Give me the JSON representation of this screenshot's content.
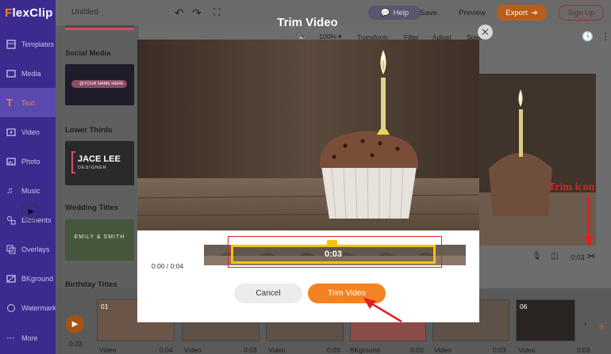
{
  "app": {
    "logo_prefix": "F",
    "logo_rest": "lexClip",
    "title": "Untitled"
  },
  "header": {
    "help": "Help",
    "save": "Save",
    "preview": "Preview",
    "export": "Export",
    "signup": "Sign Up"
  },
  "toolbar": {
    "zoom": "100%",
    "transform": "Transform",
    "filter": "Filter",
    "adjust": "Adjust",
    "speed": "Speed"
  },
  "sidebar": {
    "items": [
      {
        "label": "Templates"
      },
      {
        "label": "Media"
      },
      {
        "label": "Text"
      },
      {
        "label": "Video"
      },
      {
        "label": "Photo"
      },
      {
        "label": "Music"
      },
      {
        "label": "Elements"
      },
      {
        "label": "Overlays"
      },
      {
        "label": "BKground"
      },
      {
        "label": "Watermark"
      },
      {
        "label": "More"
      }
    ]
  },
  "panel": {
    "sections": [
      "Social Media",
      "Lower Thirds",
      "Wedding Titles",
      "Birthday Titles"
    ],
    "social_thumb_text": "@YOUR NAME HERE",
    "lower_name": "JACE LEE",
    "lower_sub": "DESIGNER",
    "wedding_text": "EMILY & SMITH"
  },
  "modal": {
    "title": "Trim Video",
    "time": "0:00 / 0:04",
    "selection_time": "0:03",
    "cancel": "Cancel",
    "trim": "Trim Video"
  },
  "preview": {
    "duration": "0:03"
  },
  "timeline": {
    "play_time": "0:23",
    "clips": [
      {
        "num": "01",
        "label": "Video",
        "dur": "0:04"
      },
      {
        "num": "",
        "label": "Video",
        "dur": "0:03"
      },
      {
        "num": "",
        "label": "Video",
        "dur": "0:03"
      },
      {
        "num": "",
        "label": "BKground",
        "dur": "0:03"
      },
      {
        "num": "",
        "label": "Video",
        "dur": "0:03"
      },
      {
        "num": "06",
        "label": "Video",
        "dur": "0:03"
      }
    ]
  },
  "annotation": {
    "label": "Trim icon"
  },
  "colors": {
    "accent": "#f58220",
    "sidebar": "#3c2a8f",
    "highlight": "#f4c20d",
    "annotation": "#e02020"
  }
}
